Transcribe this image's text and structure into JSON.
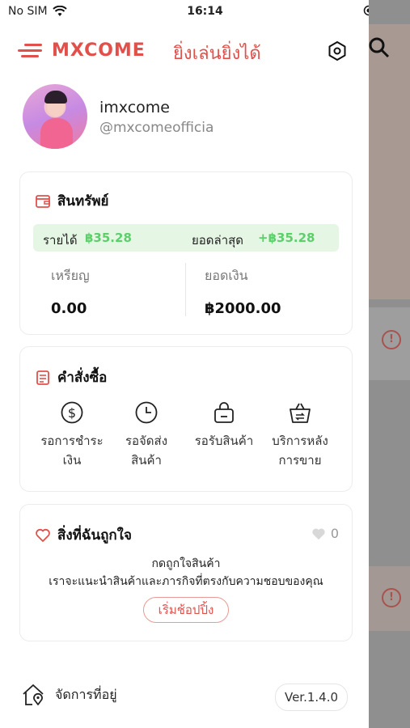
{
  "status_bar": {
    "carrier": "No SIM",
    "time": "16:14"
  },
  "header": {
    "logo": "MXCOME",
    "slogan": "ยิ่งเล่นยิ่งได้"
  },
  "profile": {
    "username": "imxcome",
    "handle": "@mxcomeofficia"
  },
  "wallet": {
    "title": "สินทรัพย์",
    "income_label": "รายได้",
    "income_value": "฿35.28",
    "latest_label": "ยอดล่าสุด",
    "latest_value": "+฿35.28",
    "coins_label": "เหรียญ",
    "coins_value": "0.00",
    "balance_label": "ยอดเงิน",
    "balance_value": "฿2000.00"
  },
  "orders": {
    "title": "คำสั่งซื้อ",
    "items": [
      {
        "line1": "รอการชำระ",
        "line2": "เงิน",
        "icon": "dollar-circle-icon"
      },
      {
        "line1": "รอจัดส่ง",
        "line2": "สินค้า",
        "icon": "clock-icon"
      },
      {
        "line1": "รอรับสินค้า",
        "line2": "",
        "icon": "bag-icon"
      },
      {
        "line1": "บริการหลัง",
        "line2": "การขาย",
        "icon": "basket-return-icon"
      }
    ]
  },
  "favorites": {
    "title": "สิ่งที่ฉันถูกใจ",
    "count": "0",
    "empty_line1": "กดถูกใจสินค้า",
    "empty_line2": "เราจะแนะนำสินค้าและภารกิจที่ตรงกับความชอบของคุณ",
    "cta": "เริ่มช้อปปิ้ง"
  },
  "footer": {
    "address_label": "จัดการที่อยู่",
    "version": "Ver.1.4.0"
  },
  "colors": {
    "brand": "#e2504c",
    "income_bg": "#e6f6e4",
    "income_text": "#5ccf6a"
  }
}
